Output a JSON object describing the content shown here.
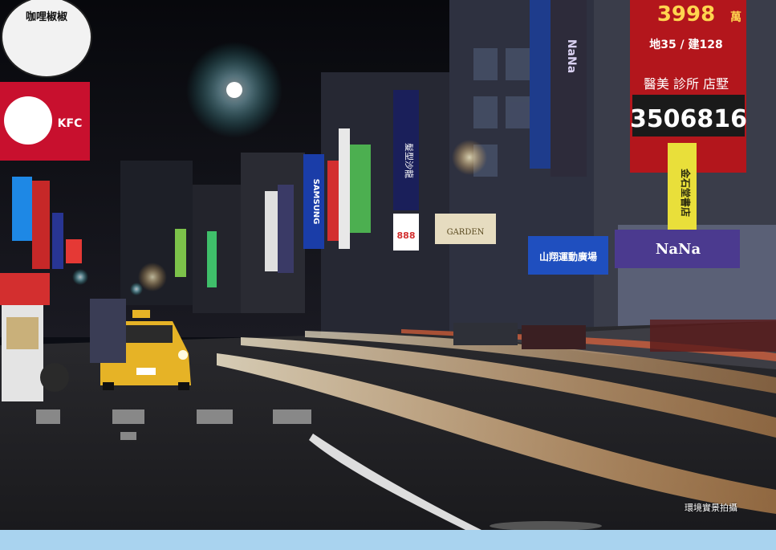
{
  "caption": "環境實景拍攝",
  "signs": {
    "kfc": "KFC",
    "samsung": "SAMSUNG",
    "price_top": "3998",
    "price_unit": "萬",
    "floor_info": "地35 / 建128",
    "clinic": "醫美 診所 店墅",
    "phone": "3506816",
    "bookstore": "金石堂書店",
    "nana": "NaNa",
    "sports": "山翔運動廣場",
    "hair": "髮型沙龍",
    "price_small": "888",
    "garden": "GARDEN",
    "curry_shop": "咖哩椒椒"
  },
  "colors": {
    "sky": "#0b0d14",
    "strip": "#a9d3ef",
    "taxi": "#e6b326",
    "light_trail": "#ffd9a0"
  }
}
